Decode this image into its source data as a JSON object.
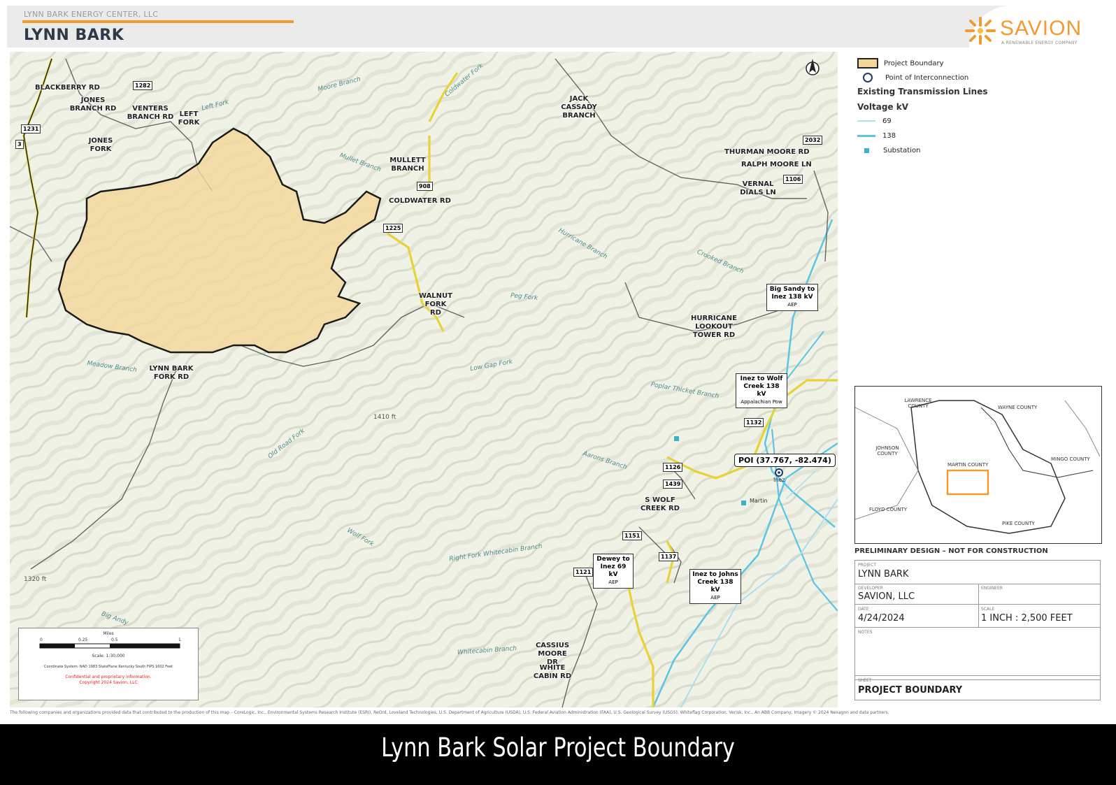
{
  "header": {
    "subtitle": "LYNN BARK ENERGY CENTER, LLC",
    "title": "LYNN BARK",
    "logo_text": "SAVION",
    "logo_tagline": "A RENEWABLE ENERGY COMPANY"
  },
  "map": {
    "roads": [
      {
        "id": "blackberry",
        "text": "BLACKBERRY RD"
      },
      {
        "id": "jones-branch",
        "text": "JONES BRANCH RD"
      },
      {
        "id": "venters",
        "text": "VENTERS BRANCH RD"
      },
      {
        "id": "left-fork",
        "text": "LEFT FORK"
      },
      {
        "id": "jones-fork",
        "text": "JONES FORK"
      },
      {
        "id": "jack-cassady",
        "text": "JACK CASSADY BRANCH"
      },
      {
        "id": "mullett",
        "text": "MULLETT BRANCH"
      },
      {
        "id": "coldwater",
        "text": "COLDWATER RD"
      },
      {
        "id": "thurman",
        "text": "THURMAN MOORE RD"
      },
      {
        "id": "ralph",
        "text": "RALPH MOORE LN"
      },
      {
        "id": "vernal",
        "text": "VERNAL DIALS LN"
      },
      {
        "id": "walnut",
        "text": "WALNUT FORK RD"
      },
      {
        "id": "hurricane",
        "text": "HURRICANE LOOKOUT TOWER RD"
      },
      {
        "id": "lynn-bark-fork",
        "text": "LYNN BARK FORK RD"
      },
      {
        "id": "s-wolf",
        "text": "S WOLF CREEK RD"
      },
      {
        "id": "cassius",
        "text": "CASSIUS MOORE DR"
      },
      {
        "id": "white-cabin",
        "text": "WHITE CABIN RD"
      }
    ],
    "shields": [
      "1282",
      "1231",
      "3",
      "908",
      "1225",
      "2032",
      "1106",
      "1132",
      "1126",
      "1439",
      "1151",
      "1137",
      "1121"
    ],
    "streams": [
      "Moore Branch",
      "Coldwater Fork",
      "Mullet Branch",
      "Left Fork",
      "Hurricane Branch",
      "Crooked Branch",
      "Peg Fork",
      "Low Gap Fork",
      "Meadow Branch",
      "Poplar Thicket Branch",
      "Aarons Branch",
      "Old Road Fork",
      "Wolf Fork",
      "Right Fork Whitecabin Branch",
      "Whitecabin Branch",
      "Big Andy"
    ],
    "callouts": [
      {
        "title": "Big Sandy to Inez 138 kV",
        "owner": "AEP"
      },
      {
        "title": "Inez to Wolf Creek 138 kV",
        "owner": "Appalachian Pow"
      },
      {
        "title": "Dewey to Inez 69 kV",
        "owner": "AEP"
      },
      {
        "title": "Inez to Johns Creek 138 kV",
        "owner": "AEP"
      }
    ],
    "poi_label": "POI (37.767, -82.474)",
    "places": [
      "Inez",
      "Martin"
    ],
    "elevation_labels": [
      "1410 ft",
      "1320 ft"
    ],
    "scale": {
      "title": "Miles",
      "ticks": [
        "0",
        "0.25",
        "0.5",
        "1"
      ],
      "ratio": "Scale: 1:30,000",
      "coord": "Coordinate System: NAD 1983 StatePlane Kentucky South FIPS 1602 Feet",
      "confidential": "Confidential and proprietary information.",
      "copyright": "Copyright 2024 Savion, LLC"
    }
  },
  "legend": {
    "project_boundary": "Project Boundary",
    "poi": "Point of Interconnection",
    "tx_heading": "Existing Transmission Lines",
    "voltage_heading": "Voltage kV",
    "v69": "69",
    "v138": "138",
    "substation": "Substation"
  },
  "inset": {
    "counties": [
      "LAWRENCE COUNTY",
      "WAYNE COUNTY",
      "JOHNSON COUNTY",
      "MARTIN COUNTY",
      "MINGO COUNTY",
      "FLOYD COUNTY",
      "PIKE COUNTY"
    ]
  },
  "titleblock": {
    "prelim": "PRELIMINARY DESIGN – NOT FOR CONSTRUCTION",
    "project_cap": "PROJECT",
    "project": "LYNN BARK",
    "developer_cap": "DEVELOPER",
    "developer": "SAVION, LLC",
    "engineer_cap": "ENGINEER",
    "date_cap": "DATE",
    "date": "4/24/2024",
    "scale_cap": "SCALE",
    "scale": "1 INCH : 2,500 FEET",
    "notes_cap": "NOTES",
    "sheet_cap": "SHEET",
    "sheet": "PROJECT BOUNDARY"
  },
  "credits": "The following companies and organizations provided data that contributed to the production of this map – CoreLogic, Inc., Environmental Systems Research Institute (ESRI), ReOrd, Loveland Technologies, U.S. Department of Agriculture (USDA), U.S. Federal Aviation Administration (FAA), U.S. Geological Survey (USGS), Whiteflag Corporation, Verisk, Inc., An ABB Company, Imagery © 2024 Nexagon and data partners.",
  "caption": "Lynn Bark Solar Project Boundary",
  "colors": {
    "boundary_fill": "#f3d79a",
    "boundary_stroke": "#1a1a1a",
    "road_yellow": "#e8d23a",
    "tx_138": "#5cc5e6",
    "tx_69": "#a9dfef",
    "orange": "#f29a2e"
  }
}
